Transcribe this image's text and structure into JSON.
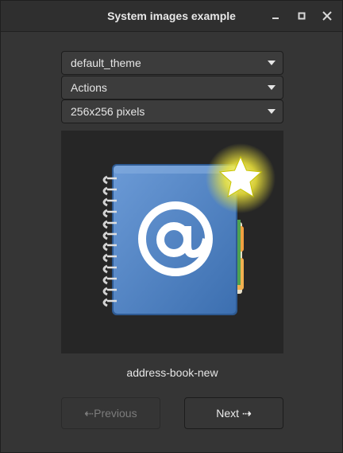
{
  "window": {
    "title": "System images example"
  },
  "combos": {
    "theme": "default_theme",
    "context": "Actions",
    "size": "256x256 pixels"
  },
  "preview": {
    "icon": "address-book-new-icon",
    "caption": "address-book-new"
  },
  "buttons": {
    "previous_label": "Previous",
    "next_label": "Next",
    "previous_enabled": false,
    "next_enabled": true
  },
  "colors": {
    "book_blue": "#4a7fc1",
    "star_yellow": "#ffe84a",
    "tab_orange": "#f0a040"
  }
}
